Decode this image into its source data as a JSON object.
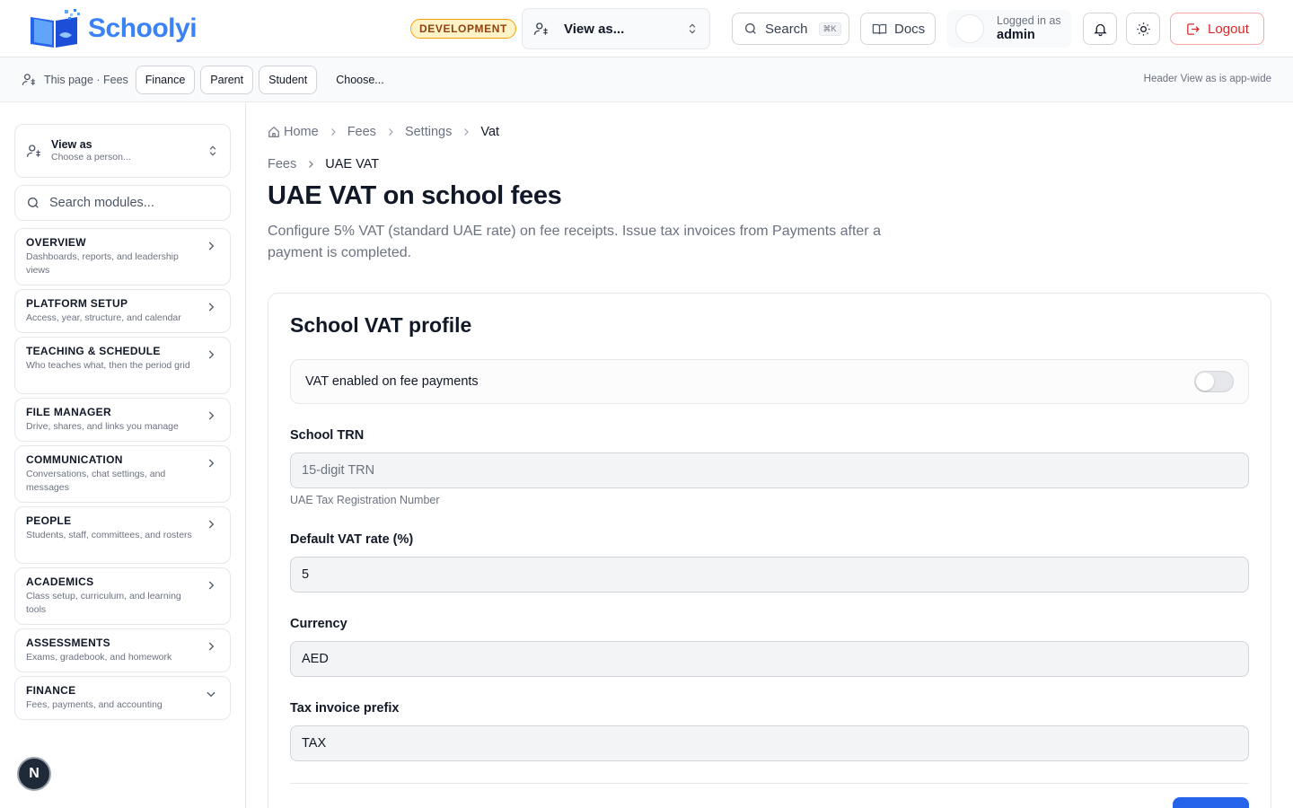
{
  "header": {
    "brand": "Schoolyi",
    "env_badge": "DEVELOPMENT",
    "view_as_label": "View as...",
    "search_label": "Search",
    "search_shortcut": "⌘K",
    "docs_label": "Docs",
    "logged_in_caption": "Logged in as",
    "username": "admin",
    "logout_label": "Logout"
  },
  "subheader": {
    "context_label": "This page · Fees",
    "chips": [
      "Finance",
      "Parent",
      "Student"
    ],
    "choose_label": "Choose...",
    "note": "Header View as is app-wide"
  },
  "sidebar": {
    "view_as_title": "View as",
    "view_as_sub": "Choose a person...",
    "search_placeholder": "Search modules...",
    "modules": [
      {
        "title": "OVERVIEW",
        "desc": "Dashboards, reports, and leadership views",
        "expanded": false
      },
      {
        "title": "PLATFORM SETUP",
        "desc": "Access, year, structure, and calendar",
        "expanded": false
      },
      {
        "title": "TEACHING & SCHEDULE",
        "desc": "Who teaches what, then the period grid",
        "expanded": false
      },
      {
        "title": "FILE MANAGER",
        "desc": "Drive, shares, and links you manage",
        "expanded": false
      },
      {
        "title": "COMMUNICATION",
        "desc": "Conversations, chat settings, and messages",
        "expanded": false
      },
      {
        "title": "PEOPLE",
        "desc": "Students, staff, committees, and rosters",
        "expanded": false
      },
      {
        "title": "ACADEMICS",
        "desc": "Class setup, curriculum, and learning tools",
        "expanded": false
      },
      {
        "title": "ASSESSMENTS",
        "desc": "Exams, gradebook, and homework",
        "expanded": false
      },
      {
        "title": "FINANCE",
        "desc": "Fees, payments, and accounting",
        "expanded": true
      }
    ],
    "fab_letter": "N"
  },
  "main": {
    "breadcrumb": [
      "Home",
      "Fees",
      "Settings",
      "Vat"
    ],
    "sub_breadcrumb": [
      "Fees",
      "UAE VAT"
    ],
    "title": "UAE VAT on school fees",
    "description": "Configure 5% VAT (standard UAE rate) on fee receipts. Issue tax invoices from Payments after a payment is completed.",
    "card": {
      "title": "School VAT profile",
      "toggle_label": "VAT enabled on fee payments",
      "toggle_on": false,
      "trn_label": "School TRN",
      "trn_placeholder": "15-digit TRN",
      "trn_value": "",
      "trn_hint": "UAE Tax Registration Number",
      "rate_label": "Default VAT rate (%)",
      "rate_value": "5",
      "currency_label": "Currency",
      "currency_value": "AED",
      "prefix_label": "Tax invoice prefix",
      "prefix_value": "TAX"
    }
  },
  "colors": {
    "brand": "#3b82f6",
    "primary_button": "#2563eb",
    "logout": "#dc2626",
    "dev_badge_bg": "#fef3c7",
    "dev_badge_border": "#f59e0b"
  }
}
